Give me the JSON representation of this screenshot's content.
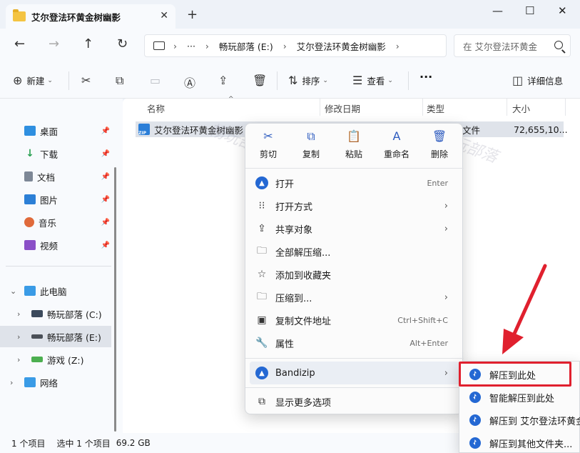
{
  "window": {
    "tab_title": "艾尔登法环黄金树幽影",
    "tab_close": "✕",
    "new_tab": "+",
    "minimize": "—",
    "maximize": "☐",
    "close": "✕"
  },
  "nav": {
    "back": "←",
    "forward": "→",
    "up": "↑",
    "refresh": "↻"
  },
  "address": {
    "more": "···",
    "segments": [
      "畅玩部落 (E:)",
      "艾尔登法环黄金树幽影"
    ],
    "separator": "›"
  },
  "search": {
    "placeholder": "在 艾尔登法环黄金"
  },
  "toolbar": {
    "new_label": "新建",
    "sort_label": "排序",
    "view_label": "查看",
    "more": "···",
    "details_label": "详细信息"
  },
  "sidebar": {
    "quick": [
      {
        "label": "桌面",
        "icon": "desktop-icon",
        "color": "#2f8fe0"
      },
      {
        "label": "下载",
        "icon": "download-icon",
        "color": "#2aa052"
      },
      {
        "label": "文档",
        "icon": "document-icon",
        "color": "#7d8796"
      },
      {
        "label": "图片",
        "icon": "pictures-icon",
        "color": "#2c7fd6"
      },
      {
        "label": "音乐",
        "icon": "music-icon",
        "color": "#e06a3b"
      },
      {
        "label": "视频",
        "icon": "video-icon",
        "color": "#8a4fc7"
      }
    ],
    "this_pc": "此电脑",
    "drives": [
      {
        "label": "畅玩部落 (C:)"
      },
      {
        "label": "畅玩部落 (E:)"
      },
      {
        "label": "游戏 (Z:)"
      }
    ],
    "network": "网络"
  },
  "columns": {
    "name": "名称",
    "modified": "修改日期",
    "type": "类型",
    "size": "大小"
  },
  "file": {
    "name": "艾尔登法环黄金树幽影",
    "type_tail": "文件",
    "size": "72,655,10..."
  },
  "watermark": {
    "text": "畅玩部落"
  },
  "context_menu": {
    "quick_actions": [
      {
        "label": "剪切",
        "icon": "✂"
      },
      {
        "label": "复制",
        "icon": "⧉"
      },
      {
        "label": "粘贴",
        "icon": "📋"
      },
      {
        "label": "重命名",
        "icon": "A"
      },
      {
        "label": "删除",
        "icon": "🗑"
      }
    ],
    "items": [
      {
        "label": "打开",
        "shortcut": "Enter"
      },
      {
        "label": "打开方式",
        "arrow": "›"
      },
      {
        "label": "共享对象",
        "arrow": "›"
      },
      {
        "label": "全部解压缩..."
      },
      {
        "label": "添加到收藏夹"
      },
      {
        "label": "压缩到...",
        "arrow": "›"
      },
      {
        "label": "复制文件地址",
        "shortcut": "Ctrl+Shift+C"
      },
      {
        "label": "属性",
        "shortcut": "Alt+Enter"
      }
    ],
    "bandizip": {
      "label": "Bandizip",
      "arrow": "›"
    },
    "more_options": "显示更多选项"
  },
  "submenu": {
    "items": [
      {
        "label": "解压到此处"
      },
      {
        "label": "智能解压到此处"
      },
      {
        "label": "解压到 艾尔登法环黄金树幽影"
      },
      {
        "label": "解压到其他文件夹..."
      }
    ]
  },
  "status": {
    "count": "1 个项目",
    "selected": "选中 1 个项目",
    "size": "69.2 GB"
  },
  "colors": {
    "accent": "#2468d3",
    "highlight_red": "#e0202e",
    "selection": "#dfe3ea"
  }
}
